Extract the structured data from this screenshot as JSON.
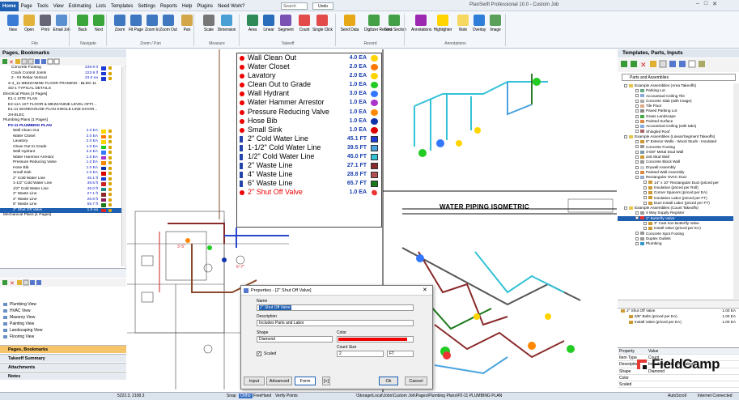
{
  "app": {
    "title": "PlanSwift Professional 10.0 - Custom Job",
    "search_placeholder": "Search",
    "undo_label": "Undo"
  },
  "menu": [
    "Home",
    "Page",
    "Tools",
    "View",
    "Estimating",
    "Lists",
    "Templates",
    "Settings",
    "Reports",
    "Help",
    "Plugins",
    "Need Work?"
  ],
  "ribbon": {
    "buttons": [
      {
        "label": "New",
        "color": "#3a7bd5"
      },
      {
        "label": "Open",
        "color": "#e2b23b"
      },
      {
        "label": "Print",
        "color": "#667"
      },
      {
        "label": "Email Job",
        "color": "#5a8fd0"
      },
      {
        "label": "Back",
        "color": "#3aa53a"
      },
      {
        "label": "Next",
        "color": "#3aa53a"
      },
      {
        "label": "Zoom",
        "color": "#3f77c0"
      },
      {
        "label": "Fit Page",
        "color": "#3f77c0"
      },
      {
        "label": "Zoom In",
        "color": "#3f77c0"
      },
      {
        "label": "Zoom Out",
        "color": "#3f77c0"
      },
      {
        "label": "Pan",
        "color": "#d4a64a"
      },
      {
        "label": "Scale",
        "color": "#777"
      },
      {
        "label": "Dimension",
        "color": "#4aa0d4"
      },
      {
        "label": "Area",
        "color": "#2e8b57"
      },
      {
        "label": "Linear",
        "color": "#2a6ebb"
      },
      {
        "label": "Segment",
        "color": "#7a52b3"
      },
      {
        "label": "Count",
        "color": "#e34b4b"
      },
      {
        "label": "Single Click",
        "color": "#e34b4b"
      },
      {
        "label": "Send Data",
        "color": "#e6a817"
      },
      {
        "label": "Digitizer Record",
        "color": "#43a047"
      },
      {
        "label": "New Section",
        "color": "#43a047"
      },
      {
        "label": "Annotations",
        "color": "#9c27b0"
      },
      {
        "label": "Highlighter",
        "color": "#ffd400"
      },
      {
        "label": "Note",
        "color": "#f6d860"
      },
      {
        "label": "Overlay",
        "color": "#2f7ed8"
      },
      {
        "label": "Image",
        "color": "#5a9f5a"
      }
    ],
    "groups": [
      "File",
      "Navigate",
      "Zoom / Pan",
      "Measure",
      "Takeoff",
      "Record",
      "Annotations"
    ]
  },
  "left_panel": {
    "title": "Pages, Bookmarks",
    "tree": [
      {
        "label": "Concrete Footing",
        "value": "249.9 ft",
        "color": "#1f3bd6",
        "indent": 14
      },
      {
        "label": "Crack Control Joints",
        "value": "223.9 lf",
        "color": "#1f3bd6",
        "indent": 14
      },
      {
        "label": "2 - #4 Rebar Vertical",
        "value": "23.0 ea",
        "color": "#1f3bd6",
        "indent": 14
      },
      {
        "label": "S-4_11 MEZZANINE FLOOR FRAMING - BLDG 11",
        "indent": 10
      },
      {
        "label": "SD-1 TYPICAL DETAILS",
        "indent": 10
      },
      {
        "label": "Electrical Plans [4 Pages]",
        "indent": 4
      },
      {
        "label": "E1-1 SITE PLAN",
        "indent": 10
      },
      {
        "label": "E2-11A 1ST FLOOR & MEZZANINE LEVEL OFFI...",
        "indent": 10
      },
      {
        "label": "E1-11 WAREHOUSE PLAN SINGLE LINE DIAGR...",
        "indent": 10
      },
      {
        "label": "2H-ELEC",
        "indent": 10
      },
      {
        "label": "Plumbing Plans [1 Pages]",
        "indent": 4
      },
      {
        "label": "P2-11 PLUMBING PLAN",
        "indent": 10,
        "bold": true
      },
      {
        "label": "Wall Clean Out",
        "value": "4.0 EA",
        "color": "#ffd400",
        "indent": 16
      },
      {
        "label": "Water Closet",
        "value": "2.0 EA",
        "color": "#ff7700",
        "indent": 16
      },
      {
        "label": "Lavatory",
        "value": "2.0 EA",
        "color": "#ffd400",
        "indent": 16
      },
      {
        "label": "Clean Out to Grade",
        "value": "1.0 EA",
        "color": "#22cc22",
        "indent": 16
      },
      {
        "label": "Wall Hydrant",
        "value": "3.0 EA",
        "color": "#3377ff",
        "indent": 16
      },
      {
        "label": "Water Hammer Arrestor",
        "value": "1.0 EA",
        "color": "#aa33cc",
        "indent": 16
      },
      {
        "label": "Pressure Reducing Valve",
        "value": "1.0 EA",
        "color": "#ff8800",
        "indent": 16
      },
      {
        "label": "Hose Bib",
        "value": "1.0 EA",
        "color": "#1133aa",
        "indent": 16
      },
      {
        "label": "Small Sink",
        "value": "1.0 EA",
        "color": "#dd0000",
        "indent": 16
      },
      {
        "label": "2\" Cold Water Line",
        "value": "45.1 ft",
        "color": "#1f3bd6",
        "indent": 16
      },
      {
        "label": "1-1/2\" Cold Water Line",
        "value": "39.5 ft",
        "color": "#cc2222",
        "indent": 16
      },
      {
        "label": "1/2\" Cold Water Line",
        "value": "45.0 ft",
        "color": "#1a8a8a",
        "indent": 16
      },
      {
        "label": "2\" Waste Line",
        "value": "27.1 ft",
        "color": "#8a2a2a",
        "indent": 16
      },
      {
        "label": "4\" Waste Line",
        "value": "28.8 ft",
        "color": "#8a1a5a",
        "indent": 16
      },
      {
        "label": "6\" Waste Line",
        "value": "65.7 ft",
        "color": "#1a7a1a",
        "indent": 16
      },
      {
        "label": "2\" Shut Off Valve",
        "value": "1.0 ea",
        "color": "#dd2222",
        "indent": 16,
        "selected": true
      },
      {
        "label": "Mechanical Plans [1 Pages]",
        "indent": 4
      }
    ],
    "views": [
      "Plumbing View",
      "HVAC View",
      "Masonry View",
      "Painting View",
      "Landscaping View",
      "Flooring View"
    ],
    "accordion": [
      "Pages, Bookmarks",
      "Takeoff Summary",
      "Attachments",
      "Notes"
    ]
  },
  "legend": [
    {
      "label": "Wall Clean Out",
      "qty": "4.0 EA",
      "color": "#ffd400",
      "kind": "count"
    },
    {
      "label": "Water Closet",
      "qty": "2.0 EA",
      "color": "#ff7700",
      "kind": "count"
    },
    {
      "label": "Lavatory",
      "qty": "2.0 EA",
      "color": "#ffd400",
      "kind": "count"
    },
    {
      "label": "Clean Out to Grade",
      "qty": "1.0 EA",
      "color": "#22cc22",
      "kind": "count"
    },
    {
      "label": "Wall Hydrant",
      "qty": "3.0 EA",
      "color": "#3377ff",
      "kind": "count"
    },
    {
      "label": "Water Hammer Arrestor",
      "qty": "1.0 EA",
      "color": "#aa33cc",
      "kind": "count"
    },
    {
      "label": "Pressure Reducing Valve",
      "qty": "1.0 EA",
      "color": "#ff8800",
      "kind": "count"
    },
    {
      "label": "Hose Bib",
      "qty": "1.0 EA",
      "color": "#1133aa",
      "kind": "count"
    },
    {
      "label": "Small Sink",
      "qty": "1.0 EA",
      "color": "#dd0000",
      "kind": "count"
    },
    {
      "label": "2\" Cold Water Line",
      "qty": "45.1 FT",
      "color": "#1f3bd6",
      "kind": "line"
    },
    {
      "label": "1-1/2\" Cold Water Line",
      "qty": "39.5 FT",
      "color": "#4aa3df",
      "kind": "line"
    },
    {
      "label": "1/2\" Cold Water Line",
      "qty": "45.0 FT",
      "color": "#33c2d6",
      "kind": "line"
    },
    {
      "label": "2\" Waste Line",
      "qty": "27.1 FT",
      "color": "#8a2a2a",
      "kind": "line"
    },
    {
      "label": "4\" Waste Line",
      "qty": "28.8 FT",
      "color": "#b05050",
      "kind": "line"
    },
    {
      "label": "6\" Waste Line",
      "qty": "65.7 FT",
      "color": "#1a7a1a",
      "kind": "line"
    },
    {
      "label": "2\" Shut Off Valve",
      "qty": "1.0 EA",
      "color": "#ee3333",
      "kind": "count",
      "red": true
    }
  ],
  "drawing": {
    "iso_title": "WATER PIPING ISOMETRIC",
    "dim1": "3'-5\"",
    "dim2": "6'-7\""
  },
  "dialog": {
    "title": "Properties - [2\" Shut Off Valve]",
    "name_label": "Name",
    "name_value": "2\" Shut Off Valve",
    "desc_label": "Description",
    "desc_value": "Includes Parts and Labor",
    "shape_label": "Shape",
    "shape_value": "Diamond",
    "color_label": "Color",
    "color_value": "#ee0000",
    "count_label": "Count Size",
    "count_value": "2",
    "count_unit": "FT",
    "scaled_label": "Scaled",
    "tabs": [
      "Input",
      "Advanced",
      "Form"
    ],
    "ok": "Ok",
    "cancel": "Cancel"
  },
  "right_panel": {
    "title": "Templates, Parts, Inputs",
    "combo": "Parts and Assemblies",
    "tree": [
      {
        "label": "Example Assemblies (Area Takeoffs)",
        "indent": 8,
        "type": "folder"
      },
      {
        "label": "Parking Lot",
        "indent": 22,
        "color": "#6a8"
      },
      {
        "label": "Accoustical Ceiling Tile",
        "indent": 22,
        "color": "#8ad"
      },
      {
        "label": "Concrete Slab (with image)",
        "indent": 22,
        "color": "#aaa"
      },
      {
        "label": "Tile Floor",
        "indent": 22,
        "color": "#da8"
      },
      {
        "label": "Paved Parking Lot",
        "indent": 22,
        "color": "#888"
      },
      {
        "label": "Grass Landscape",
        "indent": 22,
        "color": "#4a4"
      },
      {
        "label": "Painted Surface",
        "indent": 22,
        "color": "#d84"
      },
      {
        "label": "Accoustical Ceiling (with tabs)",
        "indent": 22,
        "color": "#8ad"
      },
      {
        "label": "Shingled Roof",
        "indent": 22,
        "color": "#a66"
      },
      {
        "label": "Example Assemblies (Linear/Segment Takeoffs)",
        "indent": 8,
        "type": "folder"
      },
      {
        "label": "6\" Exterior Walls - Wood Studs - Insulated",
        "indent": 22,
        "color": "#c93"
      },
      {
        "label": "Concrete Footing",
        "indent": 22,
        "color": "#999"
      },
      {
        "label": "3-5/8\" Metal Stud Wall",
        "indent": 22,
        "color": "#79a"
      },
      {
        "label": "2x6 Stud Wall",
        "indent": 22,
        "color": "#c93"
      },
      {
        "label": "Concrete Block Wall",
        "indent": 22,
        "color": "#999"
      },
      {
        "label": "Drywall Assembly",
        "indent": 22,
        "color": "#ccc"
      },
      {
        "label": "Painted Wall Assembly",
        "indent": 22,
        "color": "#d84"
      },
      {
        "label": "Rectangular HVAC Duct",
        "indent": 22,
        "color": "#9ac"
      },
      {
        "label": "14\" x 10\" Rectangular Duct (priced per",
        "indent": 32,
        "color": "#c93"
      },
      {
        "label": "Insulation (priced per Roll)",
        "indent": 32,
        "color": "#c93"
      },
      {
        "label": "Corner Spacers (priced per EA)",
        "indent": 32,
        "color": "#c93"
      },
      {
        "label": "Insulation Labor (priced per FT)",
        "indent": 32,
        "color": "#c93"
      },
      {
        "label": "Duct Install Labor (priced per FT)",
        "indent": 32,
        "color": "#c93"
      },
      {
        "label": "Example Assemblies (Count Takeoffs)",
        "indent": 8,
        "type": "folder"
      },
      {
        "label": "4 Way Supply Register",
        "indent": 22,
        "color": "#999"
      },
      {
        "label": "2\" Butterfly Valve",
        "indent": 22,
        "color": "#e33",
        "selected": true
      },
      {
        "label": "3\" Cast Iron Butterfly Valve",
        "indent": 32,
        "color": "#c93"
      },
      {
        "label": "Install Valve (priced per EA)",
        "indent": 32,
        "color": "#c93"
      },
      {
        "label": "Concrete Spot Footing",
        "indent": 22,
        "color": "#999"
      },
      {
        "label": "Duplex Outlets",
        "indent": 22,
        "color": "#999"
      },
      {
        "label": "Plumbing",
        "indent": 22,
        "color": "#39c"
      }
    ],
    "parts": [
      {
        "label": "2\" Shut Off Valve",
        "value": "1.00 EA",
        "indent": 4
      },
      {
        "label": "5/8\" Bolts (priced per EA)",
        "value": "1.00 EA",
        "indent": 14
      },
      {
        "label": "Install Valve (priced per EA)",
        "value": "1.00 EA",
        "indent": 14
      }
    ],
    "props": {
      "h_key": "Property",
      "h_val": "Value",
      "rows": [
        {
          "k": "Item Type",
          "v": "Count"
        },
        {
          "k": "Description",
          "v": "Includes Parts and Labor"
        },
        {
          "k": "Shape",
          "v": "Diamond"
        },
        {
          "k": "Color",
          "v": ""
        },
        {
          "k": "Scaled",
          "v": ""
        }
      ]
    }
  },
  "status": {
    "coords": "5222.3, 2108.3",
    "snap": "Snap",
    "ortho": "Ortho",
    "freehand": "FreeHand",
    "verify": "Verify Points",
    "path": "\\Storage\\Local\\Jobs\\Custom Job\\Pages\\Plumbing Plans\\P2-11 PLUMBING PLAN",
    "autosave": "AutoScroll",
    "internet": "Internet Connected"
  },
  "brand": {
    "name": "FieldCamp",
    "accent": "#e53935"
  }
}
